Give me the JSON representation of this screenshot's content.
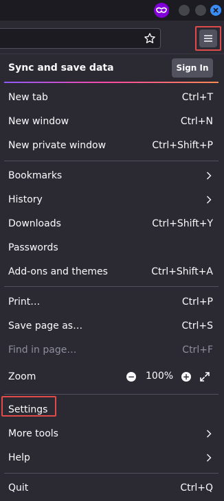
{
  "menu": {
    "sync_title": "Sync and save data",
    "sign_in": "Sign In",
    "items": {
      "new_tab": {
        "label": "New tab",
        "shortcut": "Ctrl+T"
      },
      "new_window": {
        "label": "New window",
        "shortcut": "Ctrl+N"
      },
      "new_private": {
        "label": "New private window",
        "shortcut": "Ctrl+Shift+P"
      },
      "bookmarks": {
        "label": "Bookmarks"
      },
      "history": {
        "label": "History"
      },
      "downloads": {
        "label": "Downloads",
        "shortcut": "Ctrl+Shift+Y"
      },
      "passwords": {
        "label": "Passwords"
      },
      "addons": {
        "label": "Add-ons and themes",
        "shortcut": "Ctrl+Shift+A"
      },
      "print": {
        "label": "Print…",
        "shortcut": "Ctrl+P"
      },
      "save_page": {
        "label": "Save page as…",
        "shortcut": "Ctrl+S"
      },
      "find": {
        "label": "Find in page…",
        "shortcut": "Ctrl+F"
      },
      "zoom": {
        "label": "Zoom",
        "value": "100%",
        "minus": "−",
        "plus": "+"
      },
      "settings": {
        "label": "Settings"
      },
      "more_tools": {
        "label": "More tools"
      },
      "help": {
        "label": "Help"
      },
      "quit": {
        "label": "Quit",
        "shortcut": "Ctrl+Q"
      }
    }
  },
  "colors": {
    "panel_bg": "#2b2a33",
    "highlight": "#e14b4b",
    "private_accent": "#8000d7"
  },
  "icons": [
    "private-browsing-icon",
    "minimize-icon",
    "maximize-icon",
    "close-icon",
    "star-icon",
    "hamburger-menu-icon",
    "chevron-right-icon",
    "fullscreen-icon"
  ]
}
